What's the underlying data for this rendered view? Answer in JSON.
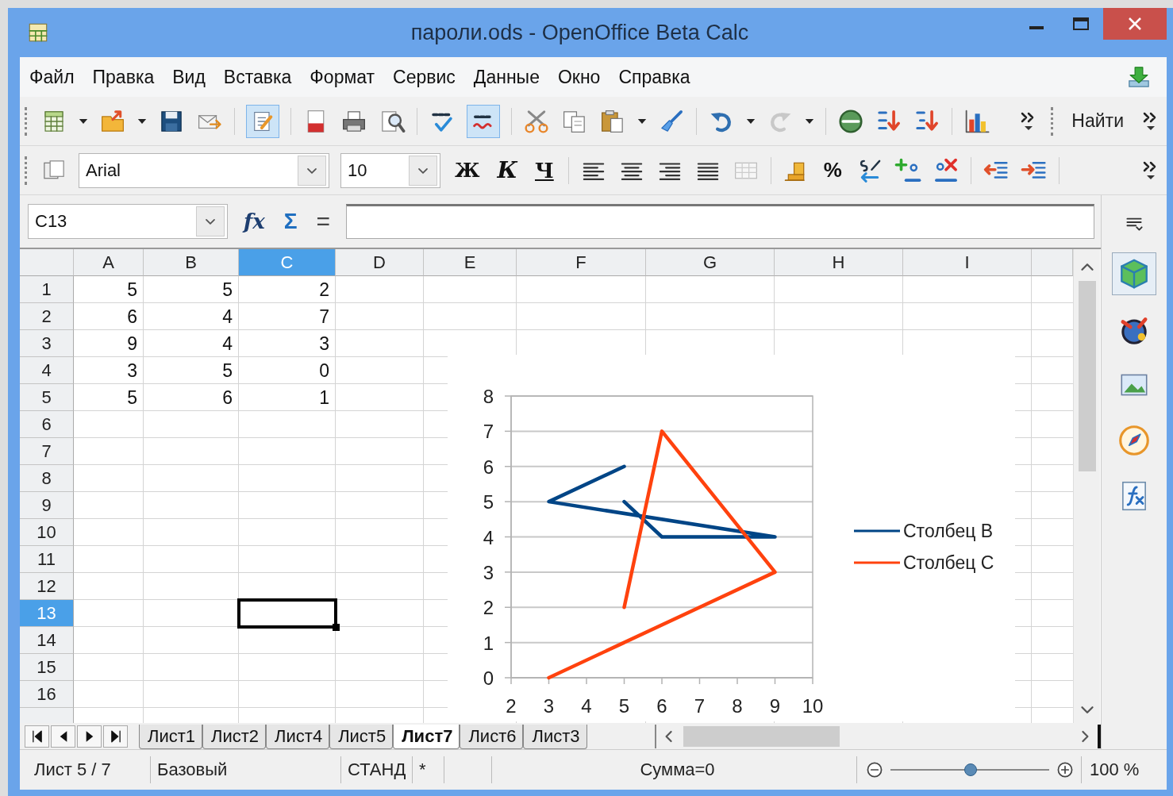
{
  "window": {
    "title": "пароли.ods - OpenOffice Beta Calc"
  },
  "menu": [
    "Файл",
    "Правка",
    "Вид",
    "Вставка",
    "Формат",
    "Сервис",
    "Данные",
    "Окно",
    "Справка"
  ],
  "toolbar": {
    "edit_mode_on": true,
    "autospell_on": true,
    "find_label": "Найти"
  },
  "format_bar": {
    "font": "Arial",
    "size": "10",
    "bold": "Ж",
    "italic": "К",
    "underline": "Ч",
    "percent": "%"
  },
  "formula_bar": {
    "name_box": "C13",
    "function_wizard": "fx",
    "sum": "Σ",
    "equals": "="
  },
  "columns": [
    {
      "label": "A",
      "selected": false
    },
    {
      "label": "B",
      "selected": false
    },
    {
      "label": "C",
      "selected": true
    },
    {
      "label": "D",
      "selected": false
    },
    {
      "label": "E",
      "selected": false
    },
    {
      "label": "F",
      "selected": false
    },
    {
      "label": "G",
      "selected": false
    },
    {
      "label": "H",
      "selected": false
    },
    {
      "label": "I",
      "selected": false
    }
  ],
  "rows": [
    {
      "label": "1",
      "selected": false,
      "cells": [
        "5",
        "5",
        "2"
      ]
    },
    {
      "label": "2",
      "selected": false,
      "cells": [
        "6",
        "4",
        "7"
      ]
    },
    {
      "label": "3",
      "selected": false,
      "cells": [
        "9",
        "4",
        "3"
      ]
    },
    {
      "label": "4",
      "selected": false,
      "cells": [
        "3",
        "5",
        "0"
      ]
    },
    {
      "label": "5",
      "selected": false,
      "cells": [
        "5",
        "6",
        "1"
      ]
    },
    {
      "label": "6",
      "selected": false
    },
    {
      "label": "7",
      "selected": false
    },
    {
      "label": "8",
      "selected": false
    },
    {
      "label": "9",
      "selected": false
    },
    {
      "label": "10",
      "selected": false
    },
    {
      "label": "11",
      "selected": false
    },
    {
      "label": "12",
      "selected": false
    },
    {
      "label": "13",
      "selected": true
    },
    {
      "label": "14",
      "selected": false
    },
    {
      "label": "15",
      "selected": false
    },
    {
      "label": "16",
      "selected": false
    }
  ],
  "chart_data": {
    "type": "line",
    "x": [
      5,
      6,
      9,
      3,
      5
    ],
    "series": [
      {
        "name": "Столбец B",
        "color": "#004586",
        "values": [
          5,
          4,
          4,
          5,
          6
        ]
      },
      {
        "name": "Столбец C",
        "color": "#ff420e",
        "values": [
          2,
          7,
          3,
          0,
          1
        ]
      }
    ],
    "grid": true,
    "legend": true,
    "xlim": [
      2,
      10
    ],
    "ylim": [
      0,
      8
    ],
    "xticks": [
      {
        "value": 2,
        "label": "2"
      },
      {
        "value": 3,
        "label": "3"
      },
      {
        "value": 4,
        "label": "4"
      },
      {
        "value": 5,
        "label": "5"
      },
      {
        "value": 6,
        "label": "6"
      },
      {
        "value": 7,
        "label": "7"
      },
      {
        "value": 8,
        "label": "8"
      },
      {
        "value": 9,
        "label": "9"
      },
      {
        "value": 10,
        "label": "10"
      }
    ],
    "yticks": [
      {
        "value": 0,
        "label": "0"
      },
      {
        "value": 1,
        "label": "1"
      },
      {
        "value": 2,
        "label": "2"
      },
      {
        "value": 3,
        "label": "3"
      },
      {
        "value": 4,
        "label": "4"
      },
      {
        "value": 5,
        "label": "5"
      },
      {
        "value": 6,
        "label": "6"
      },
      {
        "value": 7,
        "label": "7"
      },
      {
        "value": 8,
        "label": "8"
      }
    ]
  },
  "sheet_tabs": [
    {
      "label": "Лист1",
      "selected": false
    },
    {
      "label": "Лист2",
      "selected": false
    },
    {
      "label": "Лист4",
      "selected": false
    },
    {
      "label": "Лист5",
      "selected": false
    },
    {
      "label": "Лист7",
      "selected": true
    },
    {
      "label": "Лист6",
      "selected": false
    },
    {
      "label": "Лист3",
      "selected": false
    }
  ],
  "status_bar": {
    "sheet": "Лист 5 / 7",
    "style": "Базовый",
    "mode": "СТАНД",
    "modified": "*",
    "sum": "Сумма=0",
    "zoom": {
      "level": 0.5
    },
    "zoom_label": "100 %"
  }
}
